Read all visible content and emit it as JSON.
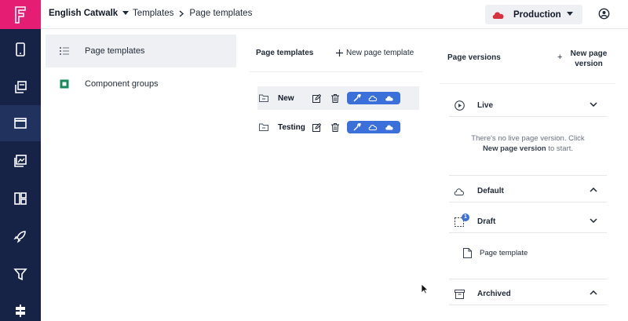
{
  "app": {
    "logo_letter": "F",
    "brand_color": "#e51e74",
    "rail_color": "#162346"
  },
  "rail": {
    "items": [
      {
        "icon": "phone-icon"
      },
      {
        "icon": "pages-icon"
      },
      {
        "icon": "window-icon",
        "active": true
      },
      {
        "icon": "media-icon"
      },
      {
        "icon": "dashboard-icon"
      },
      {
        "icon": "rocket-icon"
      },
      {
        "icon": "filter-icon"
      },
      {
        "icon": "signpost-icon"
      }
    ]
  },
  "topbar": {
    "org_name": "English Catwalk",
    "breadcrumb": [
      "Templates",
      "Page templates"
    ],
    "environment": "Production"
  },
  "sidebar": {
    "items": [
      {
        "label": "Page templates",
        "icon": "list-icon",
        "selected": true
      },
      {
        "label": "Component groups",
        "icon": "component-square-icon",
        "selected": false
      }
    ]
  },
  "templates": {
    "title": "Page templates",
    "new_label": "New page template",
    "items": [
      {
        "name": "New",
        "highlighted": true
      },
      {
        "name": "Testing",
        "highlighted": false
      }
    ]
  },
  "versions": {
    "title": "Page versions",
    "new_label_line1": "New page",
    "new_label_line2": "version",
    "sections": {
      "live": "Live",
      "default": "Default",
      "draft": "Draft",
      "archived": "Archived"
    },
    "empty_line1": "There's no live page version. Click",
    "empty_bold": "New page version",
    "empty_tail": " to start.",
    "draft_badge": "1",
    "draft_item": "Page template"
  },
  "colors": {
    "accent": "#3b6fd9",
    "cloud_red": "#d9323f"
  }
}
